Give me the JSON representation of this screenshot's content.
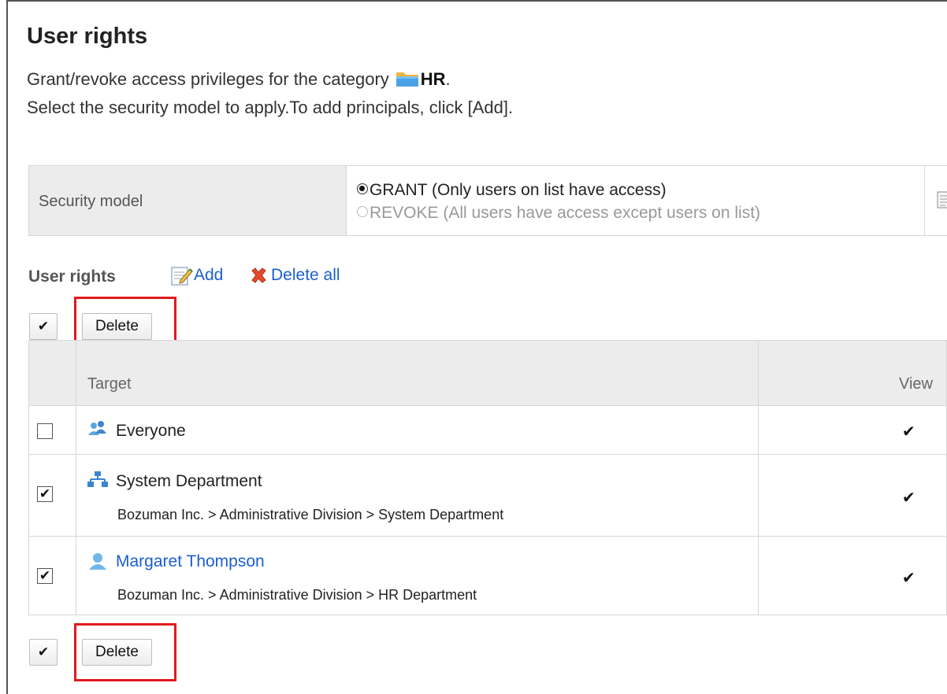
{
  "page": {
    "title": "User rights",
    "desc_prefix": "Grant/revoke access privileges for the category",
    "category": "HR",
    "desc_suffix": ".",
    "instructions": "Select the security model to apply.To add principals, click [Add]."
  },
  "security_model": {
    "label": "Security model",
    "options": [
      {
        "label": "GRANT (Only users on list have access)",
        "selected": true
      },
      {
        "label": "REVOKE (All users have access except users on list)",
        "selected": false
      }
    ]
  },
  "user_rights": {
    "section_title": "User rights",
    "add_label": "Add",
    "delete_all_label": "Delete all"
  },
  "actions": {
    "check_all": "✔",
    "delete_label": "Delete"
  },
  "table": {
    "headers": {
      "target": "Target",
      "view": "View"
    },
    "rows": [
      {
        "icon": "group-icon",
        "name": "Everyone",
        "path": "",
        "checked": false,
        "view": "✔",
        "is_link": false
      },
      {
        "icon": "organization-icon",
        "name": "System Department",
        "path": "Bozuman Inc. > Administrative Division > System Department",
        "checked": true,
        "view": "✔",
        "is_link": false
      },
      {
        "icon": "user-icon",
        "name": "Margaret Thompson",
        "path": "Bozuman Inc. > Administrative Division > HR Department",
        "checked": true,
        "view": "✔",
        "is_link": true
      }
    ]
  },
  "colors": {
    "link": "#1a5fd1",
    "highlight": "#e0191e",
    "header_bg": "#ececec"
  }
}
